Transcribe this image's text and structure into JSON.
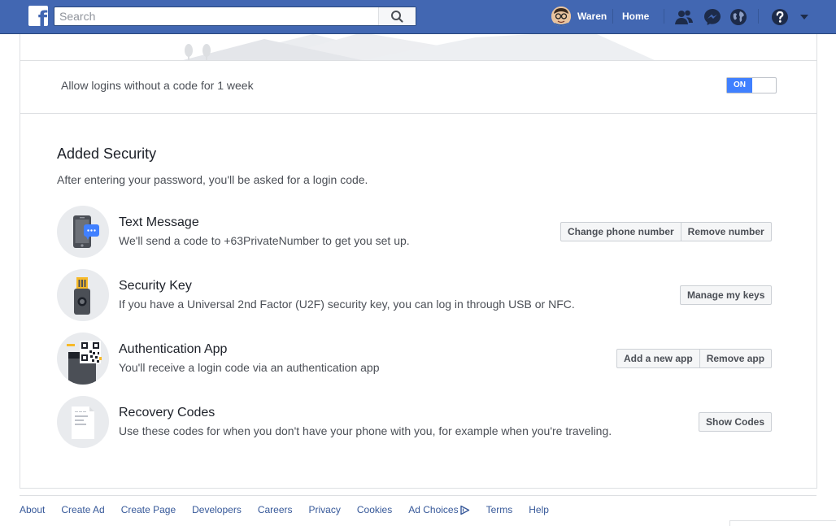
{
  "topbar": {
    "search_placeholder": "Search",
    "user_name": "Waren",
    "home_label": "Home",
    "brand_color": "#4267b2"
  },
  "two_factor": {
    "allow_text": "Allow logins without a code for 1 week",
    "toggle_label": "ON",
    "toggle_state": "on"
  },
  "added_security": {
    "title": "Added Security",
    "description": "After entering your password, you'll be asked for a login code.",
    "methods": [
      {
        "icon": "phone-message-icon",
        "title": "Text Message",
        "description": "We'll send a code to +63PrivateNumber to get you set up.",
        "buttons": [
          "Change phone number",
          "Remove number"
        ]
      },
      {
        "icon": "security-key-icon",
        "title": "Security Key",
        "description": "If you have a Universal 2nd Factor (U2F) security key, you can log in through USB or NFC.",
        "buttons": [
          "Manage my keys"
        ]
      },
      {
        "icon": "authentication-app-icon",
        "title": "Authentication App",
        "description": "You'll receive a login code via an authentication app",
        "buttons": [
          "Add a new app",
          "Remove app"
        ]
      },
      {
        "icon": "recovery-codes-icon",
        "title": "Recovery Codes",
        "description": "Use these codes for when you don't have your phone with you, for example when you're traveling.",
        "buttons": [
          "Show Codes"
        ]
      }
    ]
  },
  "footer": {
    "links": [
      "About",
      "Create Ad",
      "Create Page",
      "Developers",
      "Careers",
      "Privacy",
      "Cookies",
      "Ad Choices",
      "Terms",
      "Help"
    ]
  }
}
